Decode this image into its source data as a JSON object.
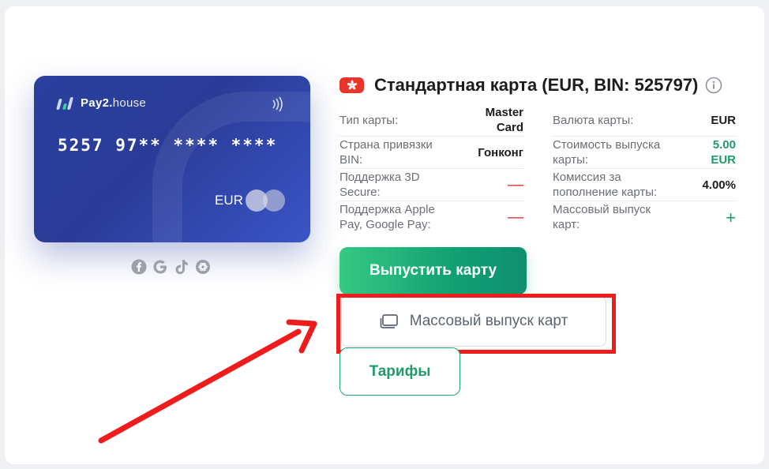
{
  "card": {
    "brand_bold": "Pay2.",
    "brand_light": "house",
    "number": "5257 97** **** ****",
    "currency": "EUR",
    "network_icon": "mastercard-logo"
  },
  "social_icons": [
    "facebook-icon",
    "google-icon",
    "tiktok-icon",
    "openai-icon"
  ],
  "header": {
    "flag": "hong-kong-flag",
    "title": "Стандартная карта (EUR, BIN: 525797)"
  },
  "specs": {
    "left": [
      {
        "label": "Тип карты:",
        "value": "Master Card"
      },
      {
        "label": "Страна привязки BIN:",
        "value": "Гонконг"
      },
      {
        "label": "Поддержка 3D Secure:",
        "value": "—"
      },
      {
        "label": "Поддержка Apple Pay, Google Pay:",
        "value": "—"
      }
    ],
    "right": [
      {
        "label": "Валюта карты:",
        "value": "EUR"
      },
      {
        "label": "Стоимость выпуска карты:",
        "value": "5.00 EUR"
      },
      {
        "label": "Комиссия за пополнение карты:",
        "value": "4.00%"
      },
      {
        "label": "Массовый выпуск карт:",
        "value": "+"
      }
    ]
  },
  "buttons": {
    "issue": "Выпустить карту",
    "mass_issue": "Массовый выпуск карт",
    "tariffs": "Тарифы"
  },
  "colors": {
    "accent_green": "#1f9a6a",
    "highlight_red": "#ee1c1c",
    "card_blue": "#2b3c98"
  }
}
